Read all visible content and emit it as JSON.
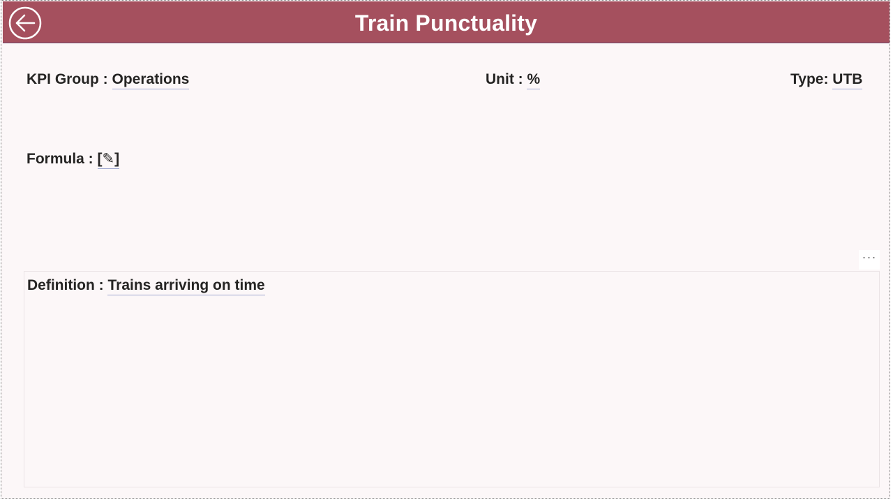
{
  "header": {
    "title": "Train Punctuality"
  },
  "fields": {
    "kpi_group_label": "KPI Group : ",
    "kpi_group_value": "Operations",
    "unit_label": "Unit : ",
    "unit_value": "%",
    "type_label": "Type: ",
    "type_value": "UTB",
    "formula_label": "Formula : ",
    "formula_value": "[✎]"
  },
  "definition": {
    "label": "Definition : ",
    "value": "Trains arriving on time"
  },
  "more_button": {
    "label": "···"
  },
  "colors": {
    "header_bg": "#a5505e",
    "page_bg": "#fcf7f8",
    "underline": "#9ea6d0",
    "text": "#252423"
  },
  "icons": {
    "back": "arrow-left-circle-icon",
    "more": "more-horizontal-icon"
  }
}
